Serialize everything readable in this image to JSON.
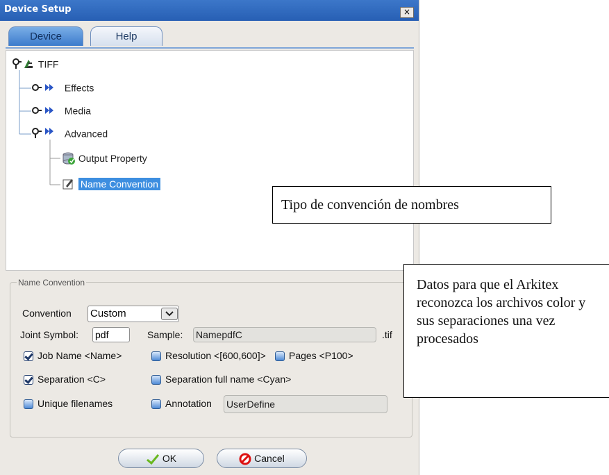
{
  "window": {
    "title": "Device Setup",
    "close_glyph": "×"
  },
  "tabs": [
    {
      "label": "Device"
    },
    {
      "label": "Help"
    }
  ],
  "tree": {
    "root": {
      "label": "TIFF"
    },
    "children": [
      {
        "label": "Effects"
      },
      {
        "label": "Media"
      },
      {
        "label": "Advanced",
        "children": [
          {
            "label": "Output Property"
          },
          {
            "label": "Name Convention"
          }
        ]
      }
    ]
  },
  "group": {
    "title": "Name Convention",
    "convention_label": "Convention",
    "convention_value": "Custom",
    "joint_symbol_label": "Joint Symbol:",
    "joint_symbol_value": "pdf",
    "sample_label": "Sample:",
    "sample_value": "NamepdfC",
    "sample_ext": ".tif",
    "options": [
      {
        "label": "Job Name <Name>",
        "checked": true
      },
      {
        "label": "Resolution <[600,600]>",
        "checked": false
      },
      {
        "label": "Pages <P100>",
        "checked": false
      },
      {
        "label": "Separation <C>",
        "checked": true
      },
      {
        "label": "Separation full name <Cyan>",
        "checked": false
      },
      {
        "label": "Unique filenames",
        "checked": false
      },
      {
        "label": "Annotation",
        "checked": false
      }
    ],
    "annotation_value": "UserDefine"
  },
  "buttons": {
    "ok": "OK",
    "cancel": "Cancel"
  },
  "callouts": {
    "naming_type": "Tipo de convención de nombres",
    "arkitex_note": "Datos para que el Arkitex reconozca los archivos color y sus separaciones una vez procesados"
  },
  "colors": {
    "titlebar": "#2f68bd",
    "selection": "#3d8ee0",
    "tab_active": "#5d97da"
  }
}
